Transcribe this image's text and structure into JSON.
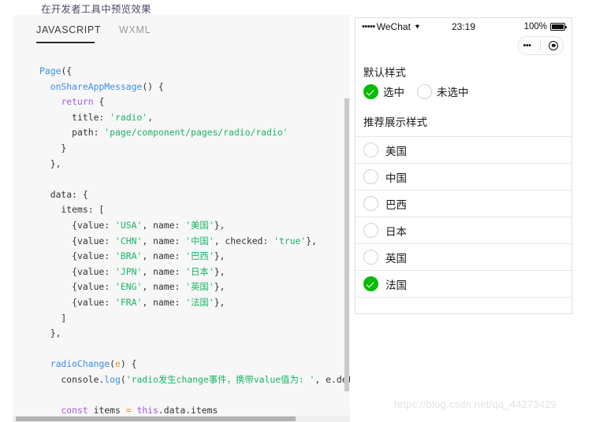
{
  "page_heading": "在开发者工具中预览效果",
  "code_panel": {
    "tabs": [
      {
        "label": "JAVASCRIPT",
        "active": true
      },
      {
        "label": "WXML",
        "active": false
      }
    ],
    "language": "javascript",
    "code_lines": [
      "Page({",
      "  onShareAppMessage() {",
      "    return {",
      "      title: 'radio',",
      "      path: 'page/component/pages/radio/radio'",
      "    }",
      "  },",
      "",
      "  data: {",
      "    items: [",
      "      {value: 'USA', name: '美国'},",
      "      {value: 'CHN', name: '中国', checked: 'true'},",
      "      {value: 'BRA', name: '巴西'},",
      "      {value: 'JPN', name: '日本'},",
      "      {value: 'ENG', name: '英国'},",
      "      {value: 'FRA', name: '法国'},",
      "    ]",
      "  },",
      "",
      "  radioChange(e) {",
      "    console.log('radio发生change事件，携带value值为: ', e.deta",
      "",
      "    const items = this.data.items"
    ]
  },
  "phone": {
    "statusbar": {
      "signal_dots": "•••••",
      "carrier": "WeChat",
      "wifi_icon": "wifi-icon",
      "time": "23:19",
      "battery_percent": "100%",
      "battery_icon": "battery-full-icon"
    },
    "capsule": {
      "menu_icon": "•••",
      "close_icon": "target-icon"
    },
    "default_section": {
      "title": "默认样式",
      "options": [
        {
          "label": "选中",
          "checked": true
        },
        {
          "label": "未选中",
          "checked": false
        }
      ]
    },
    "recommended_section": {
      "title": "推荐展示样式",
      "items": [
        {
          "label": "美国",
          "value": "USA",
          "checked": false
        },
        {
          "label": "中国",
          "value": "CHN",
          "checked": false
        },
        {
          "label": "巴西",
          "value": "BRA",
          "checked": false
        },
        {
          "label": "日本",
          "value": "JPN",
          "checked": false
        },
        {
          "label": "英国",
          "value": "ENG",
          "checked": false
        },
        {
          "label": "法国",
          "value": "FRA",
          "checked": true
        }
      ]
    }
  },
  "watermark": "https://blog.csdn.net/qq_44273429",
  "colors": {
    "wechat_green": "#09BB07",
    "panel_bg": "#f7f7f7",
    "string_token": "#18b566",
    "function_token": "#3a8ee6",
    "keyword_token": "#a955f0"
  }
}
